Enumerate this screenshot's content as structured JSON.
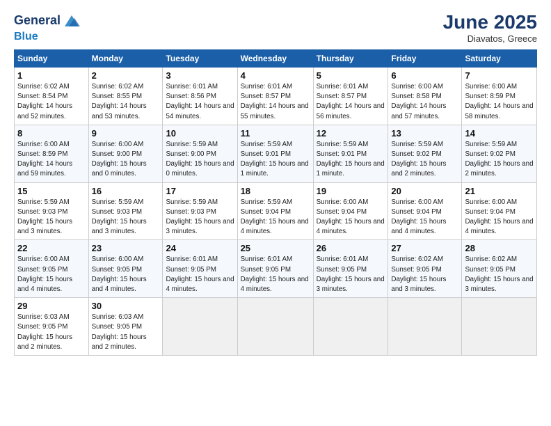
{
  "header": {
    "logo_line1": "General",
    "logo_line2": "Blue",
    "month": "June 2025",
    "location": "Diavatos, Greece"
  },
  "weekdays": [
    "Sunday",
    "Monday",
    "Tuesday",
    "Wednesday",
    "Thursday",
    "Friday",
    "Saturday"
  ],
  "weeks": [
    [
      {
        "day": "1",
        "sunrise": "6:02 AM",
        "sunset": "8:54 PM",
        "daylight": "14 hours and 52 minutes."
      },
      {
        "day": "2",
        "sunrise": "6:02 AM",
        "sunset": "8:55 PM",
        "daylight": "14 hours and 53 minutes."
      },
      {
        "day": "3",
        "sunrise": "6:01 AM",
        "sunset": "8:56 PM",
        "daylight": "14 hours and 54 minutes."
      },
      {
        "day": "4",
        "sunrise": "6:01 AM",
        "sunset": "8:57 PM",
        "daylight": "14 hours and 55 minutes."
      },
      {
        "day": "5",
        "sunrise": "6:01 AM",
        "sunset": "8:57 PM",
        "daylight": "14 hours and 56 minutes."
      },
      {
        "day": "6",
        "sunrise": "6:00 AM",
        "sunset": "8:58 PM",
        "daylight": "14 hours and 57 minutes."
      },
      {
        "day": "7",
        "sunrise": "6:00 AM",
        "sunset": "8:59 PM",
        "daylight": "14 hours and 58 minutes."
      }
    ],
    [
      {
        "day": "8",
        "sunrise": "6:00 AM",
        "sunset": "8:59 PM",
        "daylight": "14 hours and 59 minutes."
      },
      {
        "day": "9",
        "sunrise": "6:00 AM",
        "sunset": "9:00 PM",
        "daylight": "15 hours and 0 minutes."
      },
      {
        "day": "10",
        "sunrise": "5:59 AM",
        "sunset": "9:00 PM",
        "daylight": "15 hours and 0 minutes."
      },
      {
        "day": "11",
        "sunrise": "5:59 AM",
        "sunset": "9:01 PM",
        "daylight": "15 hours and 1 minute."
      },
      {
        "day": "12",
        "sunrise": "5:59 AM",
        "sunset": "9:01 PM",
        "daylight": "15 hours and 1 minute."
      },
      {
        "day": "13",
        "sunrise": "5:59 AM",
        "sunset": "9:02 PM",
        "daylight": "15 hours and 2 minutes."
      },
      {
        "day": "14",
        "sunrise": "5:59 AM",
        "sunset": "9:02 PM",
        "daylight": "15 hours and 2 minutes."
      }
    ],
    [
      {
        "day": "15",
        "sunrise": "5:59 AM",
        "sunset": "9:03 PM",
        "daylight": "15 hours and 3 minutes."
      },
      {
        "day": "16",
        "sunrise": "5:59 AM",
        "sunset": "9:03 PM",
        "daylight": "15 hours and 3 minutes."
      },
      {
        "day": "17",
        "sunrise": "5:59 AM",
        "sunset": "9:03 PM",
        "daylight": "15 hours and 3 minutes."
      },
      {
        "day": "18",
        "sunrise": "5:59 AM",
        "sunset": "9:04 PM",
        "daylight": "15 hours and 4 minutes."
      },
      {
        "day": "19",
        "sunrise": "6:00 AM",
        "sunset": "9:04 PM",
        "daylight": "15 hours and 4 minutes."
      },
      {
        "day": "20",
        "sunrise": "6:00 AM",
        "sunset": "9:04 PM",
        "daylight": "15 hours and 4 minutes."
      },
      {
        "day": "21",
        "sunrise": "6:00 AM",
        "sunset": "9:04 PM",
        "daylight": "15 hours and 4 minutes."
      }
    ],
    [
      {
        "day": "22",
        "sunrise": "6:00 AM",
        "sunset": "9:05 PM",
        "daylight": "15 hours and 4 minutes."
      },
      {
        "day": "23",
        "sunrise": "6:00 AM",
        "sunset": "9:05 PM",
        "daylight": "15 hours and 4 minutes."
      },
      {
        "day": "24",
        "sunrise": "6:01 AM",
        "sunset": "9:05 PM",
        "daylight": "15 hours and 4 minutes."
      },
      {
        "day": "25",
        "sunrise": "6:01 AM",
        "sunset": "9:05 PM",
        "daylight": "15 hours and 4 minutes."
      },
      {
        "day": "26",
        "sunrise": "6:01 AM",
        "sunset": "9:05 PM",
        "daylight": "15 hours and 3 minutes."
      },
      {
        "day": "27",
        "sunrise": "6:02 AM",
        "sunset": "9:05 PM",
        "daylight": "15 hours and 3 minutes."
      },
      {
        "day": "28",
        "sunrise": "6:02 AM",
        "sunset": "9:05 PM",
        "daylight": "15 hours and 3 minutes."
      }
    ],
    [
      {
        "day": "29",
        "sunrise": "6:03 AM",
        "sunset": "9:05 PM",
        "daylight": "15 hours and 2 minutes."
      },
      {
        "day": "30",
        "sunrise": "6:03 AM",
        "sunset": "9:05 PM",
        "daylight": "15 hours and 2 minutes."
      },
      null,
      null,
      null,
      null,
      null
    ]
  ]
}
